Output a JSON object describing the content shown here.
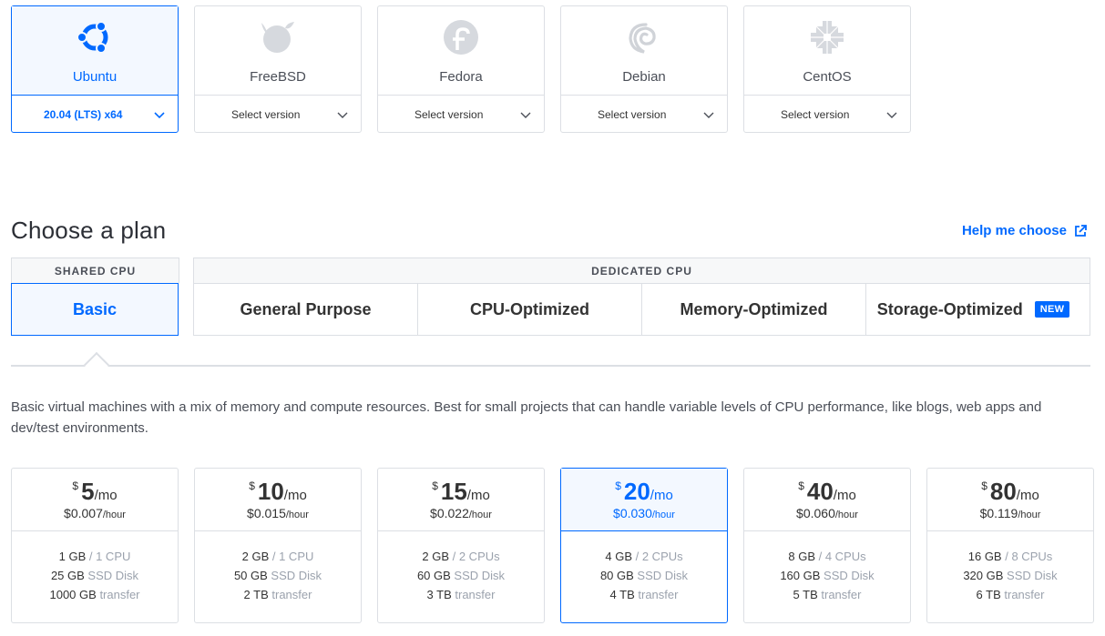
{
  "distros": [
    {
      "name": "Ubuntu",
      "version": "20.04 (LTS) x64",
      "icon": "ubuntu-icon",
      "selected": true
    },
    {
      "name": "FreeBSD",
      "version": "Select version",
      "icon": "freebsd-icon",
      "selected": false
    },
    {
      "name": "Fedora",
      "version": "Select version",
      "icon": "fedora-icon",
      "selected": false
    },
    {
      "name": "Debian",
      "version": "Select version",
      "icon": "debian-icon",
      "selected": false
    },
    {
      "name": "CentOS",
      "version": "Select version",
      "icon": "centos-icon",
      "selected": false
    }
  ],
  "plan": {
    "title": "Choose a plan",
    "help_link": "Help me choose",
    "group_shared": "SHARED CPU",
    "group_dedicated": "DEDICATED CPU",
    "tabs": [
      {
        "label": "Basic",
        "active": true
      },
      {
        "label": "General Purpose",
        "active": false
      },
      {
        "label": "CPU-Optimized",
        "active": false
      },
      {
        "label": "Memory-Optimized",
        "active": false
      },
      {
        "label": "Storage-Optimized",
        "active": false,
        "badge": "NEW"
      }
    ],
    "description": "Basic virtual machines with a mix of memory and compute resources. Best for small projects that can handle variable levels of CPU performance, like blogs, web apps and dev/test environments."
  },
  "prices": [
    {
      "currency": "$",
      "amount": "5",
      "period": "/mo",
      "hourly": "$0.007",
      "hour_unit": "/hour",
      "memory": "1 GB",
      "cpu": "/ 1 CPU",
      "disk": "25 GB",
      "disk_label": "SSD Disk",
      "transfer": "1000 GB",
      "transfer_label": "transfer",
      "selected": false
    },
    {
      "currency": "$",
      "amount": "10",
      "period": "/mo",
      "hourly": "$0.015",
      "hour_unit": "/hour",
      "memory": "2 GB",
      "cpu": "/ 1 CPU",
      "disk": "50 GB",
      "disk_label": "SSD Disk",
      "transfer": "2 TB",
      "transfer_label": "transfer",
      "selected": false
    },
    {
      "currency": "$",
      "amount": "15",
      "period": "/mo",
      "hourly": "$0.022",
      "hour_unit": "/hour",
      "memory": "2 GB",
      "cpu": "/ 2 CPUs",
      "disk": "60 GB",
      "disk_label": "SSD Disk",
      "transfer": "3 TB",
      "transfer_label": "transfer",
      "selected": false
    },
    {
      "currency": "$",
      "amount": "20",
      "period": "/mo",
      "hourly": "$0.030",
      "hour_unit": "/hour",
      "memory": "4 GB",
      "cpu": "/ 2 CPUs",
      "disk": "80 GB",
      "disk_label": "SSD Disk",
      "transfer": "4 TB",
      "transfer_label": "transfer",
      "selected": true
    },
    {
      "currency": "$",
      "amount": "40",
      "period": "/mo",
      "hourly": "$0.060",
      "hour_unit": "/hour",
      "memory": "8 GB",
      "cpu": "/ 4 CPUs",
      "disk": "160 GB",
      "disk_label": "SSD Disk",
      "transfer": "5 TB",
      "transfer_label": "transfer",
      "selected": false
    },
    {
      "currency": "$",
      "amount": "80",
      "period": "/mo",
      "hourly": "$0.119",
      "hour_unit": "/hour",
      "memory": "16 GB",
      "cpu": "/ 8 CPUs",
      "disk": "320 GB",
      "disk_label": "SSD Disk",
      "transfer": "6 TB",
      "transfer_label": "transfer",
      "selected": false
    }
  ],
  "colors": {
    "accent": "#0069ff",
    "selected_bg": "#f3f8ff",
    "border": "#dcdfe4",
    "muted": "#9ba2ad"
  }
}
